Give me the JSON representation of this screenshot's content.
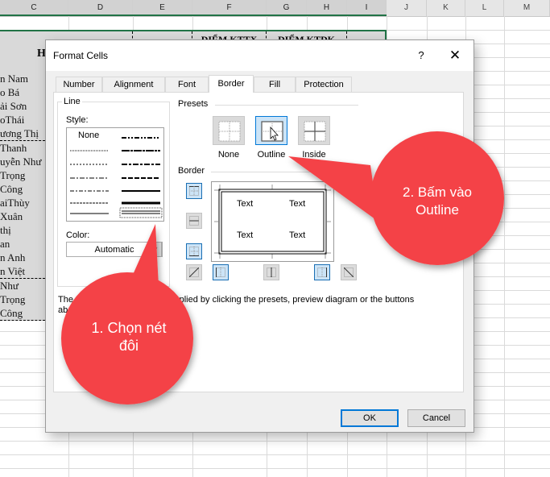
{
  "spreadsheet": {
    "columns": [
      "C",
      "D",
      "E",
      "F",
      "G",
      "H",
      "I",
      "J",
      "K",
      "L",
      "M"
    ],
    "header_cells": {
      "f": "ĐIỂM KTTX",
      "g": "ĐIỂM KTĐK",
      "h_partial": "H"
    },
    "name_fragments": [
      "n Nam",
      "o Bá",
      "ải Sơn",
      "oThái",
      "ương Thị",
      " Thanh",
      "uyễn Như",
      " Trọng",
      " Công",
      "aiThùy",
      " Xuân",
      "thị",
      "an",
      "n Anh",
      "n Việt",
      " Như",
      " Trọng",
      " Công"
    ]
  },
  "dialog": {
    "title": "Format Cells",
    "help_label": "?",
    "close_label": "✕",
    "tabs": [
      {
        "label": "Number",
        "active": false
      },
      {
        "label": "Alignment",
        "active": false
      },
      {
        "label": "Font",
        "active": false
      },
      {
        "label": "Border",
        "active": true
      },
      {
        "label": "Fill",
        "active": false
      },
      {
        "label": "Protection",
        "active": false
      }
    ],
    "line": {
      "group_label": "Line",
      "style_label": "Style:",
      "style_none": "None",
      "selected_style": "double",
      "color_label": "Color:",
      "color_value": "Automatic"
    },
    "presets": {
      "label": "Presets",
      "items": [
        {
          "label": "None",
          "selected": false
        },
        {
          "label": "Outline",
          "selected": true
        },
        {
          "label": "Inside",
          "selected": false
        }
      ]
    },
    "border": {
      "label": "Border",
      "preview_text": [
        "Text",
        "Text",
        "Text",
        "Text"
      ],
      "buttons": {
        "top": true,
        "middle_horizontal": false,
        "bottom": true,
        "diagonal_up": false,
        "left": true,
        "middle_vertical": false,
        "right": true,
        "diagonal_down": false
      }
    },
    "note": "The selected border style can be applied by clicking the presets, preview diagram or the buttons above.",
    "note_visible_start": "The",
    "note_visible_mid": "be applied by clicking the presets, preview diagram or the buttons",
    "note_visible_line2": "ab",
    "ok_label": "OK",
    "cancel_label": "Cancel"
  },
  "annotations": {
    "callout_1": "1. Chọn nét đôi",
    "callout_1_line1": "1. Chọn nét",
    "callout_1_line2": "đôi",
    "callout_2_line1": "2. Bấm vào",
    "callout_2_line2": "Outline",
    "color": "#f44347"
  },
  "colors": {
    "excel_green": "#217346",
    "selection_blue": "#0078d7",
    "selected_fill": "#cce4f7"
  }
}
